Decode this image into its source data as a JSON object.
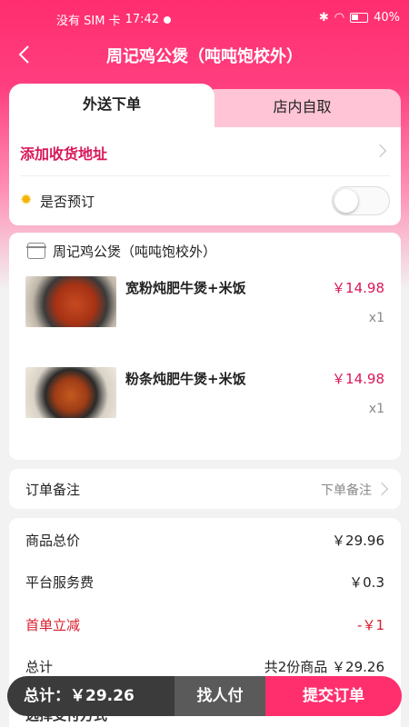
{
  "status_bar": {
    "carrier": "没有 SIM 卡",
    "time": "17:42",
    "battery": "40%"
  },
  "header": {
    "title": "周记鸡公煲（吨吨饱校外）",
    "back_icon": "back-arrow-icon"
  },
  "tabs": [
    {
      "label": "外送下单",
      "active": true
    },
    {
      "label": "店内自取",
      "active": false
    }
  ],
  "delivery": {
    "address_label": "添加收货地址",
    "reserve_label": "是否预订",
    "reserve_enabled": false
  },
  "order": {
    "store_name": "周记鸡公煲（吨吨饱校外）",
    "items": [
      {
        "name": "宽粉炖肥牛煲+米饭",
        "price": "￥14.98",
        "qty": "x1"
      },
      {
        "name": "粉条炖肥牛煲+米饭",
        "price": "￥14.98",
        "qty": "x1"
      }
    ]
  },
  "note": {
    "label": "订单备注",
    "hint": "下单备注"
  },
  "summary": {
    "goods_total_label": "商品总价",
    "goods_total": "￥29.96",
    "service_fee_label": "平台服务费",
    "service_fee": "￥0.3",
    "discount_label": "首单立减",
    "discount": "-￥1",
    "total_label": "总计",
    "total": "共2份商品 ￥29.26",
    "payment_label": "选择支付方式"
  },
  "bottom_bar": {
    "total": "总计：￥29.26",
    "find_pay": "找人付",
    "submit": "提交订单"
  },
  "colors": {
    "brand": "#ff2d6f",
    "accent_text": "#d9185b",
    "discount": "#d81e2c"
  }
}
